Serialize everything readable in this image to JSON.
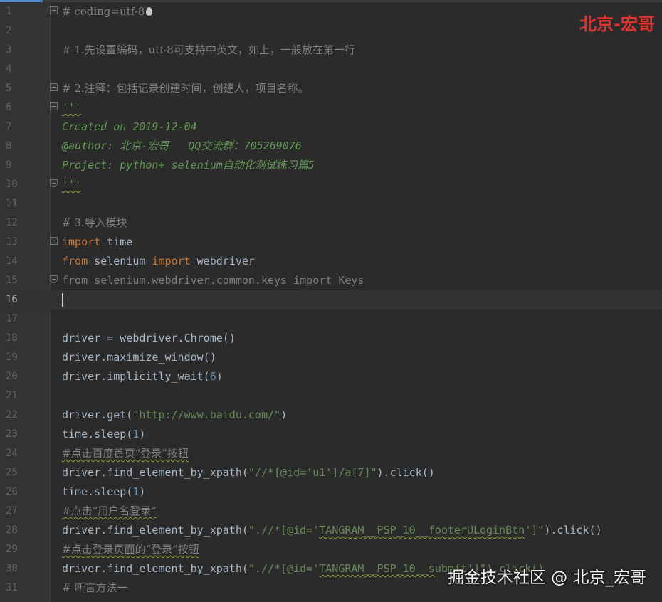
{
  "watermark_top": "北京-宏哥",
  "watermark_bottom": "掘金技术社区 @ 北京_宏哥",
  "lines": {
    "l1": {
      "n": "1",
      "t": "# coding=utf-8"
    },
    "l2": {
      "n": "2",
      "t": ""
    },
    "l3": {
      "n": "3",
      "t": "# 1.先设置编码，utf-8可支持中英文，如上，一般放在第一行"
    },
    "l4": {
      "n": "4",
      "t": ""
    },
    "l5": {
      "n": "5",
      "t": "# 2.注释：包括记录创建时间，创建人，项目名称。"
    },
    "l6": {
      "n": "6",
      "t": "'''"
    },
    "l7": {
      "n": "7",
      "t": "Created on 2019-12-04"
    },
    "l8": {
      "n": "8",
      "t": "@author: 北京-宏哥   QQ交流群：705269076"
    },
    "l9": {
      "n": "9",
      "t": "Project: python+ selenium自动化测试练习篇5"
    },
    "l10": {
      "n": "10",
      "t": "'''"
    },
    "l11": {
      "n": "11",
      "t": ""
    },
    "l12": {
      "n": "12",
      "t": "# 3.导入模块"
    },
    "l13": {
      "n": "13",
      "a": "import",
      "b": " time"
    },
    "l14": {
      "n": "14",
      "a": "from",
      "b": " selenium ",
      "c": "import",
      "d": " webdriver"
    },
    "l15": {
      "n": "15",
      "t": "from selenium.webdriver.common.keys import Keys"
    },
    "l16": {
      "n": "16",
      "t": ""
    },
    "l17": {
      "n": "17",
      "t": ""
    },
    "l18": {
      "n": "18",
      "t": "driver = webdriver.Chrome()"
    },
    "l19": {
      "n": "19",
      "t": "driver.maximize_window()"
    },
    "l20": {
      "n": "20",
      "a": "driver.implicitly_wait(",
      "b": "6",
      "c": ")"
    },
    "l21": {
      "n": "21",
      "t": ""
    },
    "l22": {
      "n": "22",
      "a": "driver.get(",
      "b": "\"http://www.baidu.com/\"",
      "c": ")"
    },
    "l23": {
      "n": "23",
      "a": "time.sleep(",
      "b": "1",
      "c": ")"
    },
    "l24": {
      "n": "24",
      "t": "#点击百度首页“登录”按钮"
    },
    "l25": {
      "n": "25",
      "a": "driver.find_element_by_xpath(",
      "b": "\"//*[@id='u1']/a[7]\"",
      "c": ").click()"
    },
    "l26": {
      "n": "26",
      "a": "time.sleep(",
      "b": "1",
      "c": ")"
    },
    "l27": {
      "n": "27",
      "t": "#点击“用户名登录”"
    },
    "l28": {
      "n": "28",
      "a": "driver.find_element_by_xpath(",
      "b": "\".//*[@id='",
      "c": "TANGRAM__PSP_10__footerULoginBtn",
      "d": "']\"",
      "e": ").click()"
    },
    "l29": {
      "n": "29",
      "t": "#点击登录页面的“登录”按钮"
    },
    "l30": {
      "n": "30",
      "a": "driver.find_element_by_xpath(",
      "b": "\".//*[@id='",
      "c": "TANGRAM__PSP_10__s",
      "d": "ubmit']\").click()"
    },
    "l31": {
      "n": "31",
      "t": "# 断言方法一"
    }
  }
}
